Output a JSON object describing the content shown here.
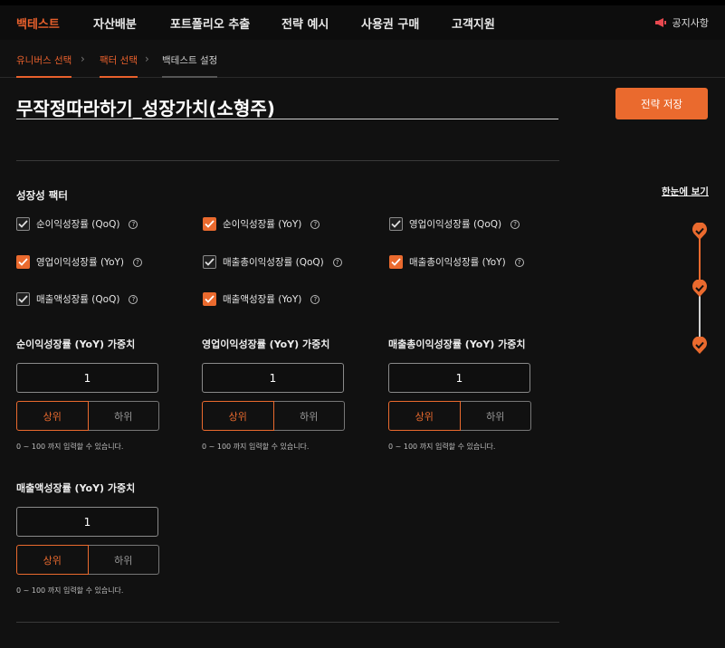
{
  "nav": {
    "items": [
      "백테스트",
      "자산배분",
      "포트폴리오 추출",
      "전략 예시",
      "사용권 구매",
      "고객지원"
    ],
    "notice": "공지사항"
  },
  "steps": [
    "유니버스 선택",
    "팩터 선택",
    "백테스트 설정"
  ],
  "strategy_title": "무작정따라하기_성장가치(소형주)",
  "save_label": "전략 저장",
  "section_title": "성장성 팩터",
  "overview_label": "한눈에 보기",
  "checkboxes": [
    {
      "label": "순이익성장률 (QoQ)",
      "checked": false
    },
    {
      "label": "순이익성장률 (YoY)",
      "checked": true
    },
    {
      "label": "영업이익성장률 (QoQ)",
      "checked": false
    },
    {
      "label": "영업이익성장률 (YoY)",
      "checked": true
    },
    {
      "label": "매출총이익성장률 (QoQ)",
      "checked": false
    },
    {
      "label": "매출총이익성장률 (YoY)",
      "checked": true
    },
    {
      "label": "매출액성장률 (QoQ)",
      "checked": false
    },
    {
      "label": "매출액성장률 (YoY)",
      "checked": true
    }
  ],
  "help_glyph": "?",
  "weights": [
    {
      "label": "순이익성장률 (YoY) 가중치",
      "value": "1",
      "top": "상위",
      "bottom": "하위",
      "hint": "0 ~ 100 까지 입력할 수 있습니다."
    },
    {
      "label": "영업이익성장률 (YoY) 가중치",
      "value": "1",
      "top": "상위",
      "bottom": "하위",
      "hint": "0 ~ 100 까지 입력할 수 있습니다."
    },
    {
      "label": "매출총이익성장률 (YoY) 가중치",
      "value": "1",
      "top": "상위",
      "bottom": "하위",
      "hint": "0 ~ 100 까지 입력할 수 있습니다."
    },
    {
      "label": "매출액성장률 (YoY) 가중치",
      "value": "1",
      "top": "상위",
      "bottom": "하위",
      "hint": "0 ~ 100 까지 입력할 수 있습니다."
    }
  ],
  "colors": {
    "accent": "#ea6a2e",
    "background": "#111111"
  }
}
